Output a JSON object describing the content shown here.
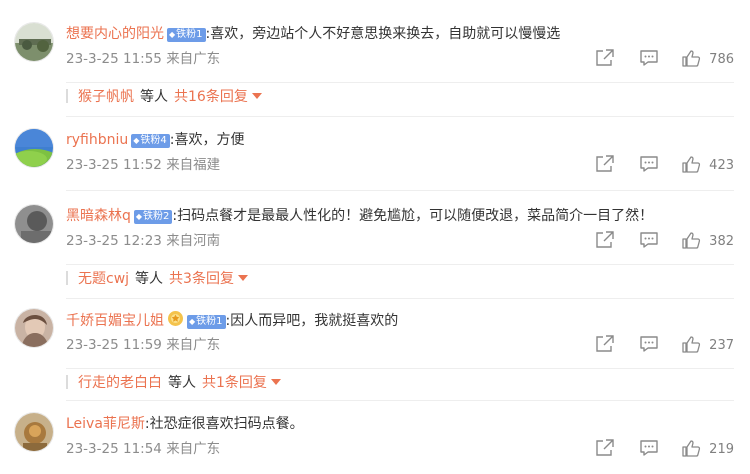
{
  "comments": [
    {
      "username": "想要内心的阳光",
      "badge": "铁粉1",
      "text": ":喜欢，旁边站个人不好意思换来换去，自助就可以慢慢选",
      "timestamp": "23-3-25 11:55",
      "location": "来自广东",
      "likes": "786",
      "reply": {
        "user": "猴子帆帆",
        "suffix": "等人",
        "total": "共16条回复"
      }
    },
    {
      "username": "ryfihbniu",
      "badge": "铁粉4",
      "text": ":喜欢，方便",
      "timestamp": "23-3-25 11:52",
      "location": "来自福建",
      "likes": "423"
    },
    {
      "username": "黑暗森林q",
      "badge": "铁粉2",
      "text": ":扫码点餐才是最最人性化的！避免尴尬，可以随便改退，菜品简介一目了然！",
      "timestamp": "23-3-25 12:23",
      "location": "来自河南",
      "likes": "382",
      "reply": {
        "user": "无题cwj",
        "suffix": "等人",
        "total": "共3条回复"
      }
    },
    {
      "username": "千娇百媚宝儿姐",
      "badge": "铁粉1",
      "text": ":因人而异吧，我就挺喜欢的",
      "timestamp": "23-3-25 11:59",
      "location": "来自广东",
      "likes": "237",
      "reply": {
        "user": "行走的老白白",
        "suffix": "等人",
        "total": "共1条回复"
      }
    },
    {
      "username": "Leiva菲尼斯",
      "text": ":社恐症很喜欢扫码点餐。",
      "timestamp": "23-3-25 11:54",
      "location": "来自广东",
      "likes": "219"
    }
  ],
  "icons": {
    "forward": "share-icon",
    "comment": "comment-icon",
    "like": "thumbs-up-icon",
    "badge": "diamond-icon"
  },
  "colors": {
    "username": "#eb7350",
    "badge": "#6d9ce8",
    "meta": "#8c8c8c"
  }
}
